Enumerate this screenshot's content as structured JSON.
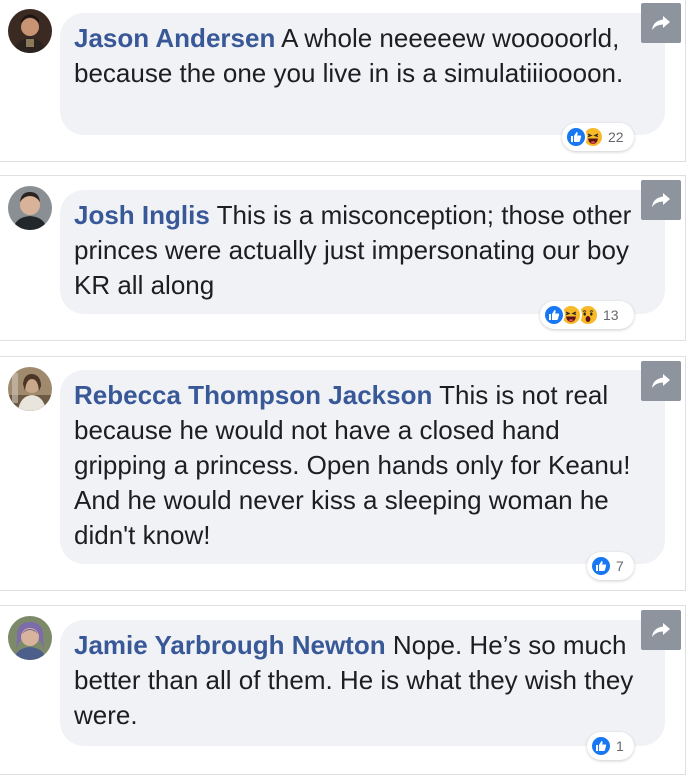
{
  "comments": [
    {
      "author": "Jason Andersen",
      "text": "A whole neeeeew wooooorld, because the one you live in is a simulatiiioooon.",
      "reaction_count": "22",
      "reactions": [
        "like-icon",
        "haha-icon"
      ]
    },
    {
      "author": "Josh Inglis",
      "text": "This is a misconception; those other princes were actually just impersonating our boy KR all along",
      "reaction_count": "13",
      "reactions": [
        "like-icon",
        "haha-icon",
        "wow-icon"
      ]
    },
    {
      "author": "Rebecca Thompson Jackson",
      "text": "This is not real because he would not have a closed hand gripping a princess. Open hands only for Keanu! And he would never kiss a sleeping woman he didn't know!",
      "reaction_count": "7",
      "reactions": [
        "like-icon"
      ]
    },
    {
      "author": "Jamie Yarbrough Newton",
      "text": "Nope. He’s so much better than all of them. He is what they wish they were.",
      "reaction_count": "1",
      "reactions": [
        "like-icon"
      ]
    }
  ],
  "icons": {
    "share": "share-arrow-icon",
    "like": "like-icon",
    "haha": "haha-icon",
    "wow": "wow-icon"
  },
  "colors": {
    "author": "#385898",
    "bubble": "#f0f2f5",
    "share_button": "#8d949e",
    "like": "#1877f2",
    "emoji": "#f7b928"
  }
}
